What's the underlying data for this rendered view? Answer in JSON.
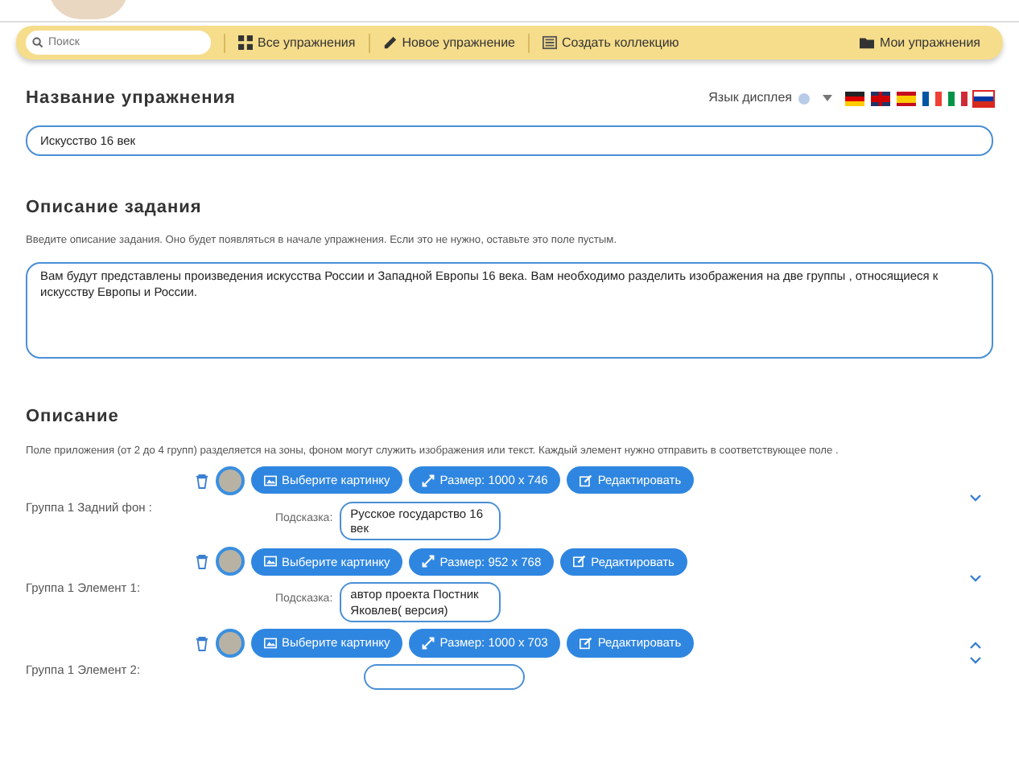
{
  "toolbar": {
    "search": {
      "placeholder": "Поиск"
    },
    "links": [
      {
        "kind": "grid",
        "label": "Все упражнения"
      },
      {
        "kind": "pencil",
        "label": "Новое упражнение"
      },
      {
        "kind": "collection",
        "label": "Создать коллекцию"
      }
    ],
    "right_link": {
      "kind": "folder",
      "label": "Мои упражнения"
    }
  },
  "title_section": {
    "heading": "Название упражнения",
    "language_label": "Язык дисплея",
    "languages": [
      {
        "kind": "de",
        "selected": false
      },
      {
        "kind": "gb",
        "selected": false
      },
      {
        "kind": "es",
        "selected": false
      },
      {
        "kind": "fr",
        "selected": false
      },
      {
        "kind": "it",
        "selected": false
      },
      {
        "kind": "ru",
        "selected": true
      }
    ],
    "value": "Искусство 16 век"
  },
  "task_section": {
    "heading": "Описание задания",
    "hint": "Введите описание задания. Оно будет появляться в начале упражнения. Если это не нужно, оставьте это поле пустым.",
    "value": "Вам будут представлены произведения искусства России и Западной Европы 16 века. Вам необходимо разделить изображения на две группы , относящиеся к искусству Европы и России."
  },
  "description_section": {
    "heading": "Описание",
    "text": "Поле приложения (от 2 до 4 групп) разделяется на зоны, фоном могут служить изображения или текст. Каждый элемент нужно отправить в соответствующее поле .",
    "rows": [
      {
        "label": "Группа 1 Задний фон :",
        "choose_button": "Выберите картинку",
        "size_button": "Размер: 1000 x 746",
        "edit_button": "Редактировать",
        "hint_label": "Подсказка:",
        "hint": "Русское государство 16 век",
        "move_up": false,
        "move_down": true
      },
      {
        "label": "Группа 1 Элемент 1:",
        "choose_button": "Выберите картинку",
        "size_button": "Размер: 952 x 768",
        "edit_button": "Редактировать",
        "hint_label": "Подсказка:",
        "hint": "автор проекта Постник Яковлев( версия)",
        "move_up": false,
        "move_down": true
      },
      {
        "label": "Группа 1 Элемент 2:",
        "choose_button": "Выберите картинку",
        "size_button": "Размер: 1000 x 703",
        "edit_button": "Редактировать",
        "move_up": true,
        "move_down": true
      }
    ]
  }
}
